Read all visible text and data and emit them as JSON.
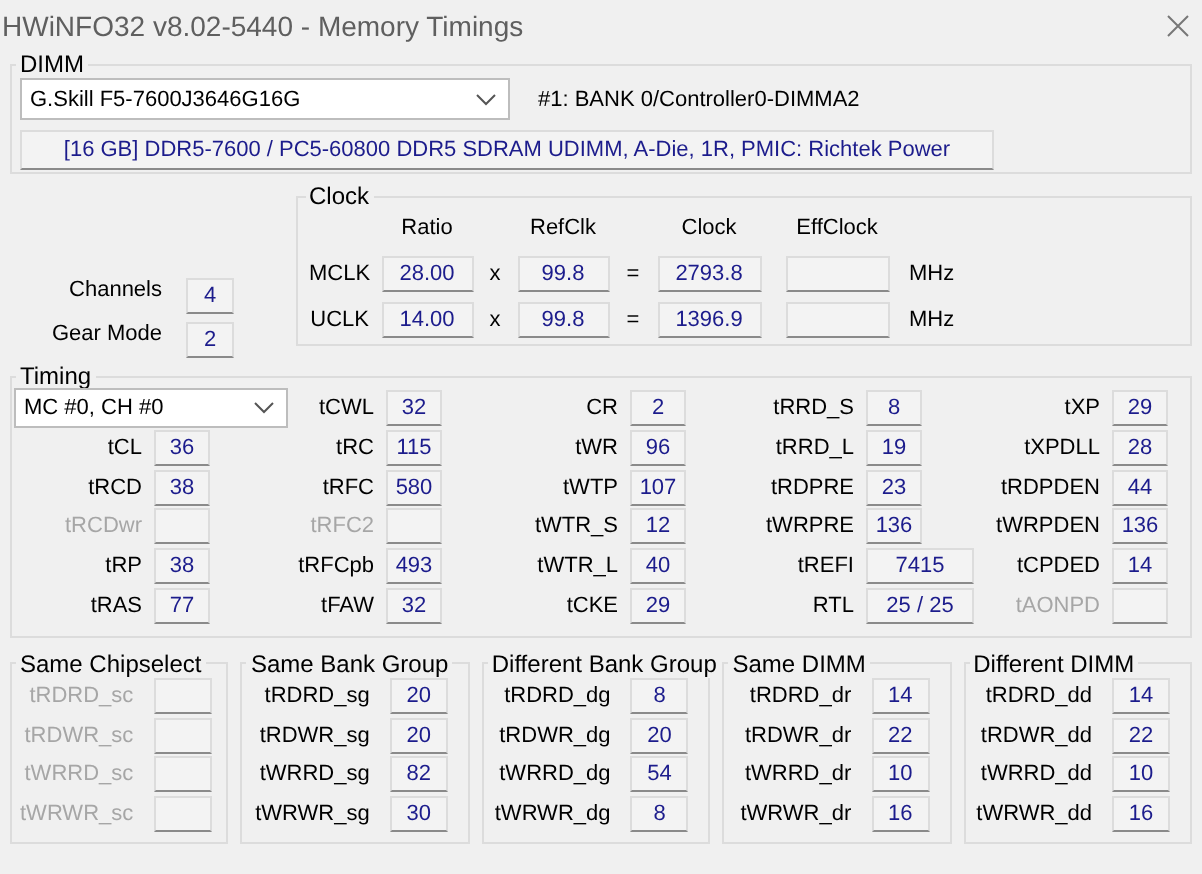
{
  "window": {
    "title": "HWiNFO32 v8.02-5440 - Memory Timings"
  },
  "dimm": {
    "legend": "DIMM",
    "module": "G.Skill F5-7600J3646G16G",
    "slot": "#1: BANK 0/Controller0-DIMMA2",
    "summary": "[16 GB] DDR5-7600 / PC5-60800 DDR5 SDRAM UDIMM, A-Die, 1R, PMIC: Richtek Power"
  },
  "memory": [
    {
      "label": "Channels",
      "value": "4"
    },
    {
      "label": "Gear Mode",
      "value": "2"
    }
  ],
  "clock": {
    "legend": "Clock",
    "headers": [
      "Ratio",
      "RefClk",
      "Clock",
      "EffClock"
    ],
    "rows": [
      {
        "label": "MCLK",
        "ratio": "28.00",
        "times": "x",
        "refclk": "99.8",
        "equals": "=",
        "clock": "2793.8",
        "unit": "MHz"
      },
      {
        "label": "UCLK",
        "ratio": "14.00",
        "times": "x",
        "refclk": "99.8",
        "equals": "=",
        "clock": "1396.9",
        "unit": "MHz"
      }
    ]
  },
  "timing": {
    "legend": "Timing",
    "selector": "MC #0, CH #0",
    "columns": [
      [
        {
          "label": "tCL",
          "value": "36",
          "disabled": false
        },
        {
          "label": "tRCD",
          "value": "38",
          "disabled": false
        },
        {
          "label": "tRCDwr",
          "disabled": true
        },
        {
          "label": "tRP",
          "value": "38",
          "disabled": false
        },
        {
          "label": "tRAS",
          "value": "77",
          "disabled": false
        }
      ],
      [
        {
          "label": "tCWL",
          "value": "32",
          "disabled": false
        },
        {
          "label": "tRC",
          "value": "115",
          "disabled": false
        },
        {
          "label": "tRFC",
          "value": "580",
          "disabled": false
        },
        {
          "label": "tRFC2",
          "disabled": true
        },
        {
          "label": "tRFCpb",
          "value": "493",
          "disabled": false
        },
        {
          "label": "tFAW",
          "value": "32",
          "disabled": false
        }
      ],
      [
        {
          "label": "CR",
          "value": "2",
          "disabled": false
        },
        {
          "label": "tWR",
          "value": "96",
          "disabled": false
        },
        {
          "label": "tWTP",
          "value": "107",
          "disabled": false
        },
        {
          "label": "tWTR_S",
          "value": "12",
          "disabled": false
        },
        {
          "label": "tWTR_L",
          "value": "40",
          "disabled": false
        },
        {
          "label": "tCKE",
          "value": "29",
          "disabled": false
        }
      ],
      [
        {
          "label": "tRRD_S",
          "value": "8",
          "disabled": false
        },
        {
          "label": "tRRD_L",
          "value": "19",
          "disabled": false
        },
        {
          "label": "tRDPRE",
          "value": "23",
          "disabled": false
        },
        {
          "label": "tWRPRE",
          "value": "136",
          "disabled": false
        },
        {
          "label": "tREFI",
          "value": "7415",
          "disabled": false
        },
        {
          "label": "RTL",
          "value": "25 / 25",
          "disabled": false
        }
      ],
      [
        {
          "label": "tXP",
          "value": "29",
          "disabled": false
        },
        {
          "label": "tXPDLL",
          "value": "28",
          "disabled": false
        },
        {
          "label": "tRDPDEN",
          "value": "44",
          "disabled": false
        },
        {
          "label": "tWRPDEN",
          "value": "136",
          "disabled": false
        },
        {
          "label": "tCPDED",
          "value": "14",
          "disabled": false
        },
        {
          "label": "tAONPD",
          "disabled": true
        }
      ]
    ]
  },
  "groups": [
    {
      "legend": "Same Chipselect",
      "rows": [
        {
          "label": "tRDRD_sc",
          "disabled": true
        },
        {
          "label": "tRDWR_sc",
          "disabled": true
        },
        {
          "label": "tWRRD_sc",
          "disabled": true
        },
        {
          "label": "tWRWR_sc",
          "disabled": true
        }
      ]
    },
    {
      "legend": "Same Bank Group",
      "rows": [
        {
          "label": "tRDRD_sg",
          "value": "20",
          "disabled": false
        },
        {
          "label": "tRDWR_sg",
          "value": "20",
          "disabled": false
        },
        {
          "label": "tWRRD_sg",
          "value": "82",
          "disabled": false
        },
        {
          "label": "tWRWR_sg",
          "value": "30",
          "disabled": false
        }
      ]
    },
    {
      "legend": "Different Bank Group",
      "rows": [
        {
          "label": "tRDRD_dg",
          "value": "8",
          "disabled": false
        },
        {
          "label": "tRDWR_dg",
          "value": "20",
          "disabled": false
        },
        {
          "label": "tWRRD_dg",
          "value": "54",
          "disabled": false
        },
        {
          "label": "tWRWR_dg",
          "value": "8",
          "disabled": false
        }
      ]
    },
    {
      "legend": "Same DIMM",
      "rows": [
        {
          "label": "tRDRD_dr",
          "value": "14",
          "disabled": false
        },
        {
          "label": "tRDWR_dr",
          "value": "22",
          "disabled": false
        },
        {
          "label": "tWRRD_dr",
          "value": "10",
          "disabled": false
        },
        {
          "label": "tWRWR_dr",
          "value": "16",
          "disabled": false
        }
      ]
    },
    {
      "legend": "Different DIMM",
      "rows": [
        {
          "label": "tRDRD_dd",
          "value": "14",
          "disabled": false
        },
        {
          "label": "tRDWR_dd",
          "value": "22",
          "disabled": false
        },
        {
          "label": "tWRRD_dd",
          "value": "10",
          "disabled": false
        },
        {
          "label": "tWRWR_dd",
          "value": "16",
          "disabled": false
        }
      ]
    }
  ]
}
